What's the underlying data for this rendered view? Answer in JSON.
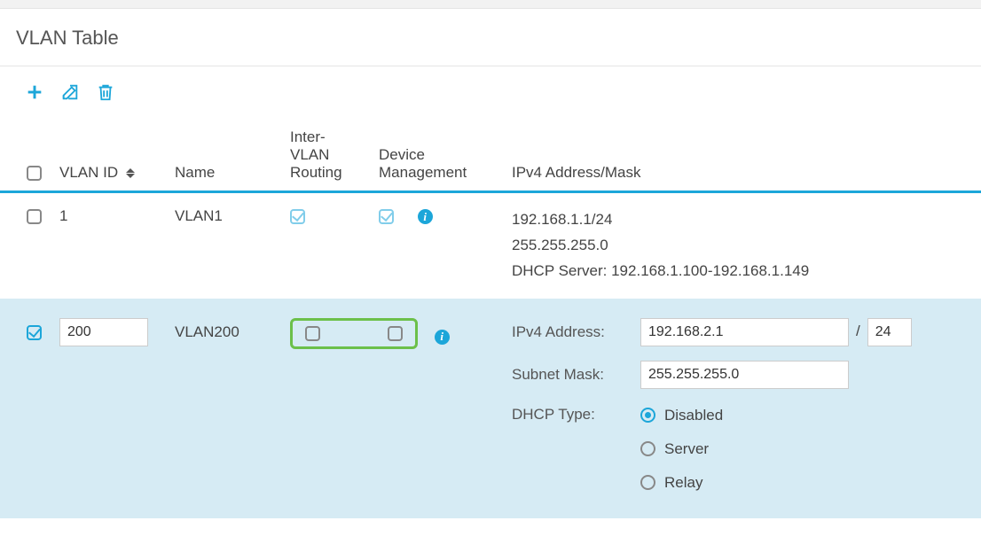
{
  "title": "VLAN Table",
  "headers": {
    "vlan_id": "VLAN ID",
    "name": "Name",
    "inter_vlan": "Inter-VLAN Routing",
    "device_mgmt": "Device Management",
    "ipv4": "IPv4 Address/Mask"
  },
  "row1": {
    "vlan_id": "1",
    "name": "VLAN1",
    "addr1": "192.168.1.1/24",
    "addr2": "255.255.255.0",
    "addr3": "DHCP Server: 192.168.1.100-192.168.1.149"
  },
  "row2": {
    "vlan_id_value": "200",
    "name": "VLAN200",
    "form": {
      "ipv4_label": "IPv4 Address:",
      "ipv4_value": "192.168.2.1",
      "mask_slash": "/",
      "mask_bits": "24",
      "subnet_label": "Subnet Mask:",
      "subnet_value": "255.255.255.0",
      "dhcp_label": "DHCP Type:",
      "dhcp_options": {
        "disabled": "Disabled",
        "server": "Server",
        "relay": "Relay"
      }
    }
  }
}
